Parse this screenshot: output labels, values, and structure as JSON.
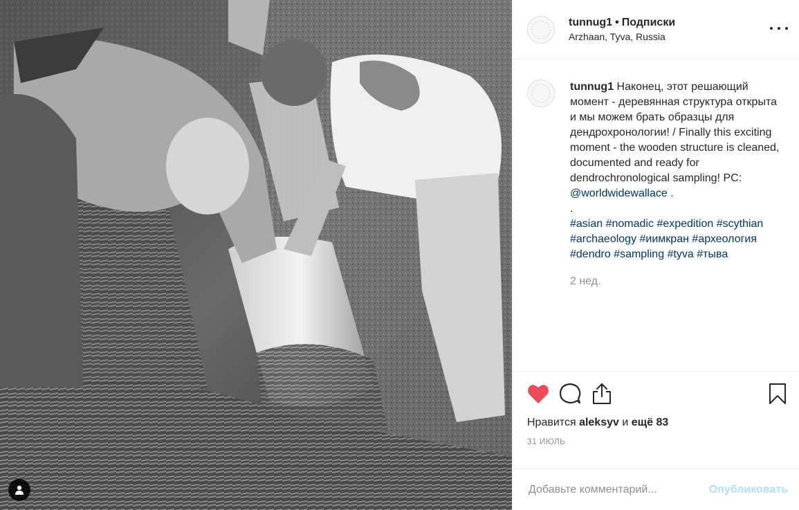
{
  "post": {
    "username": "tunnug1",
    "separator": "•",
    "follow_label": "Подписки",
    "location": "Arzhaan, Tyva, Russia"
  },
  "caption": {
    "username": "tunnug1",
    "text_before_link": "Наконец, этот решающий момент - деревянная структура открыта и мы можем брать образцы для дендрохронологии! / Finally this exciting moment - the wooden structure is cleaned, documented and ready for dendrochronological sampling! PC: ",
    "mention": "@worldwidewallace",
    "text_after_link": " .",
    "dot_line": ".",
    "hashtags": [
      "#asian",
      "#nomadic",
      "#expedition",
      "#scythian",
      "#archaeology",
      "#иимкран",
      "#археология",
      "#dendro",
      "#sampling",
      "#tyva",
      "#тыва"
    ],
    "time_ago": "2 нед."
  },
  "actions": {
    "like_icon": "heart-filled-icon",
    "comment_icon": "comment-icon",
    "share_icon": "share-icon",
    "save_icon": "bookmark-icon",
    "like_color": "#ed4956"
  },
  "likes": {
    "prefix": "Нравится",
    "user": "aleksyv",
    "middle": "и",
    "rest": "ещё 83"
  },
  "date": "31 ИЮЛЬ",
  "comment": {
    "placeholder": "Добавьте комментарий...",
    "publish_label": "Опубликовать"
  },
  "photo": {
    "user_tag_icon": "person-icon"
  }
}
